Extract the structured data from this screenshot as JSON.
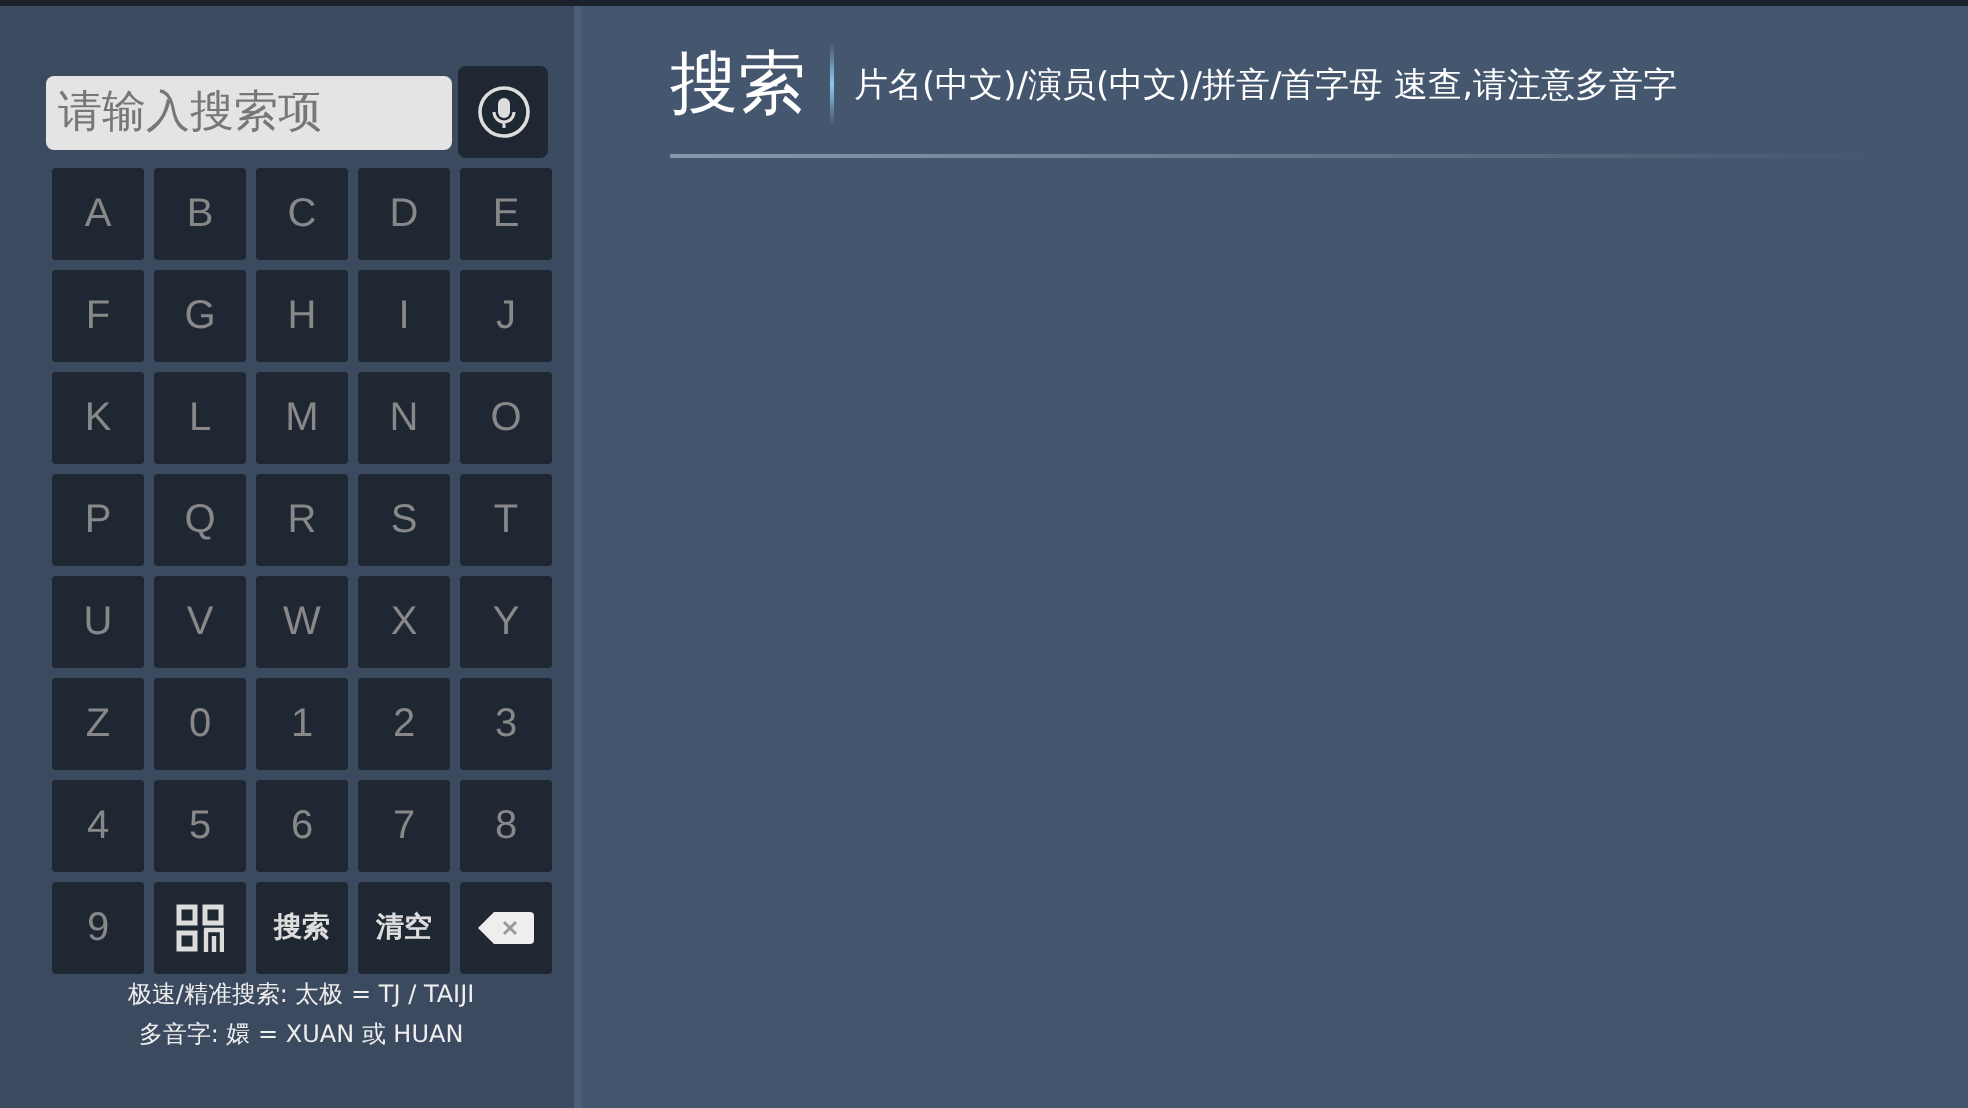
{
  "search": {
    "placeholder": "请输入搜索项"
  },
  "keys": [
    {
      "kind": "char",
      "label": "A"
    },
    {
      "kind": "char",
      "label": "B"
    },
    {
      "kind": "char",
      "label": "C"
    },
    {
      "kind": "char",
      "label": "D"
    },
    {
      "kind": "char",
      "label": "E"
    },
    {
      "kind": "char",
      "label": "F"
    },
    {
      "kind": "char",
      "label": "G"
    },
    {
      "kind": "char",
      "label": "H"
    },
    {
      "kind": "char",
      "label": "I"
    },
    {
      "kind": "char",
      "label": "J"
    },
    {
      "kind": "char",
      "label": "K"
    },
    {
      "kind": "char",
      "label": "L"
    },
    {
      "kind": "char",
      "label": "M"
    },
    {
      "kind": "char",
      "label": "N"
    },
    {
      "kind": "char",
      "label": "O"
    },
    {
      "kind": "char",
      "label": "P"
    },
    {
      "kind": "char",
      "label": "Q"
    },
    {
      "kind": "char",
      "label": "R"
    },
    {
      "kind": "char",
      "label": "S"
    },
    {
      "kind": "char",
      "label": "T"
    },
    {
      "kind": "char",
      "label": "U"
    },
    {
      "kind": "char",
      "label": "V"
    },
    {
      "kind": "char",
      "label": "W"
    },
    {
      "kind": "char",
      "label": "X"
    },
    {
      "kind": "char",
      "label": "Y"
    },
    {
      "kind": "char",
      "label": "Z"
    },
    {
      "kind": "char",
      "label": "0"
    },
    {
      "kind": "char",
      "label": "1"
    },
    {
      "kind": "char",
      "label": "2"
    },
    {
      "kind": "char",
      "label": "3"
    },
    {
      "kind": "char",
      "label": "4"
    },
    {
      "kind": "char",
      "label": "5"
    },
    {
      "kind": "char",
      "label": "6"
    },
    {
      "kind": "char",
      "label": "7"
    },
    {
      "kind": "char",
      "label": "8"
    },
    {
      "kind": "char",
      "label": "9"
    },
    {
      "kind": "qr"
    },
    {
      "kind": "text",
      "label": "搜索"
    },
    {
      "kind": "text",
      "label": "清空"
    },
    {
      "kind": "backspace"
    }
  ],
  "hints": [
    "极速/精准搜索: 太极 = TJ / TAIJI",
    "多音字: 嬛 = XUAN 或 HUAN"
  ],
  "header": {
    "title": "搜索",
    "subtitle": "片名(中文)/演员(中文)/拼音/首字母 速查,请注意多音字"
  }
}
